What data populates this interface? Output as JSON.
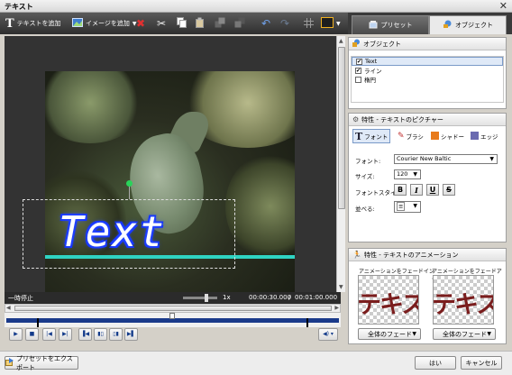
{
  "window": {
    "title": "テキスト",
    "close_glyph": "✕"
  },
  "toolbar": {
    "add_text_label": "テキストを追加",
    "add_image_label": "イメージを追加"
  },
  "tabs": [
    {
      "label": "プリセット",
      "icon": "preset-icon",
      "active": false
    },
    {
      "label": "オブジェクト",
      "icon": "object-icon",
      "active": true
    }
  ],
  "preview": {
    "overlay_text": "Text"
  },
  "status": {
    "state": "一時停止",
    "zoom": "1x",
    "current_time": "00:00:30.000",
    "separator": "/",
    "total_time": "00:01:00.000"
  },
  "objects_panel": {
    "header": "オブジェクト",
    "items": [
      {
        "label": "Text",
        "checked": true,
        "selected": true
      },
      {
        "label": "ライン",
        "checked": true,
        "selected": false
      },
      {
        "label": "楕円",
        "checked": false,
        "selected": false
      }
    ]
  },
  "properties_panel": {
    "header": "特性 - テキストのピクチャー",
    "subtabs": [
      {
        "label": "フォント",
        "icon": "font-icon",
        "active": true
      },
      {
        "label": "ブラシ",
        "icon": "brush-icon",
        "active": false
      },
      {
        "label": "シャドー",
        "icon": "shadow-icon",
        "active": false
      },
      {
        "label": "エッジ",
        "icon": "edge-icon",
        "active": false
      }
    ],
    "font_label": "フォント:",
    "font_value": "Courier New Baltic",
    "size_label": "サイズ:",
    "size_value": "120",
    "style_label": "フォントスタイル:",
    "style_buttons": [
      "B",
      "I",
      "U",
      "S"
    ],
    "align_label": "並べる:",
    "align_glyph": "≡"
  },
  "animation_panel": {
    "header": "特性 - テキストのアニメーション",
    "fade_in_label": "アニメーションをフェードイン",
    "fade_out_label": "アニメーションをフェードアウト",
    "thumb_text": "テキスト",
    "fade_in_value": "全体のフェード",
    "fade_out_value": "全体のフェード"
  },
  "footer": {
    "export_label": "プリセットをエクスポート",
    "ok_label": "はい",
    "cancel_label": "キャンセル"
  },
  "colors": {
    "text_glow": "#1030ff",
    "underline_bar": "#2fd3c2",
    "rotate_handle": "#29d35a",
    "playhead": "#1a3a8a"
  }
}
